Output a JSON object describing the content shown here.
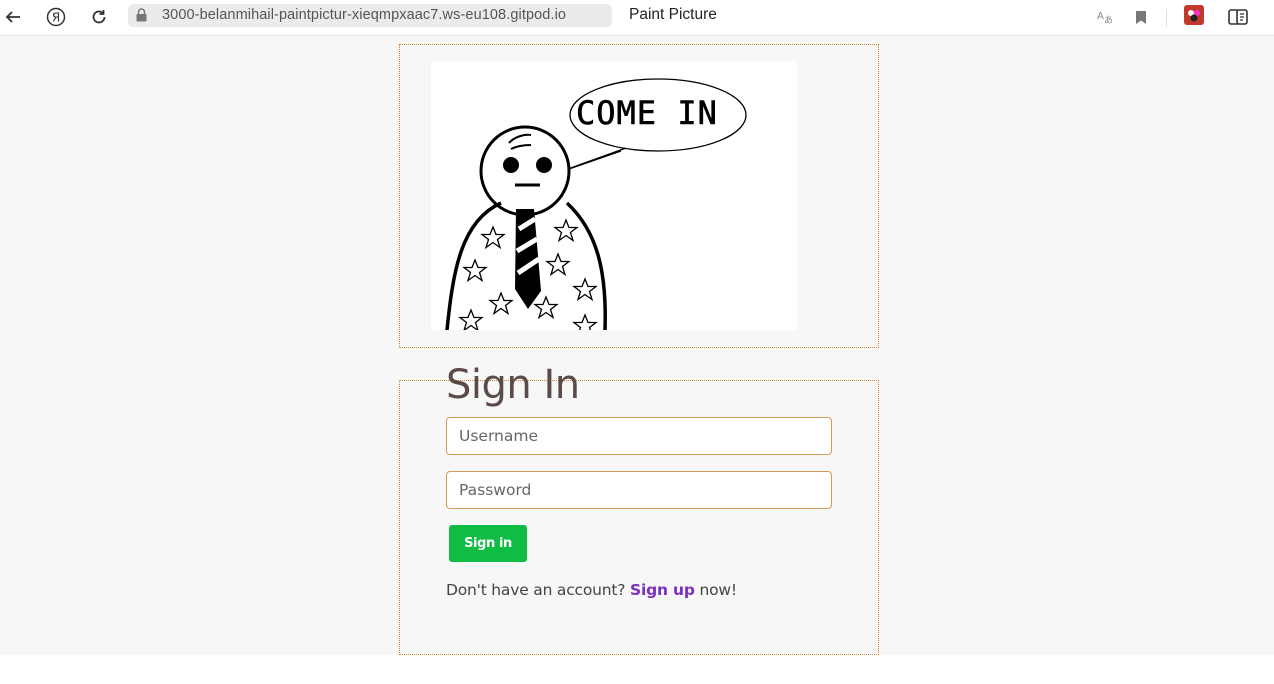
{
  "browser": {
    "url": "3000-belanmihail-paintpictur-xieqmpxaac7.ws-eu108.gitpod.io",
    "page_title": "Paint Picture",
    "icons": [
      "back-arrow-icon",
      "yandex-icon",
      "reload-icon",
      "lock-icon",
      "translate-icon",
      "bookmark-icon",
      "extension-icon",
      "reader-icon"
    ]
  },
  "picture": {
    "speech_text": "COME IN"
  },
  "signin": {
    "title": "Sign In",
    "username_placeholder": "Username",
    "password_placeholder": "Password",
    "button_label": "Sign in",
    "no_account_text": "Don't have an account?",
    "signup_link": "Sign up",
    "now_text": "now!"
  },
  "colors": {
    "frame_border": "#d9822b",
    "button": "#0fbd44",
    "link": "#7b2fbf",
    "title": "#5a4a48"
  }
}
